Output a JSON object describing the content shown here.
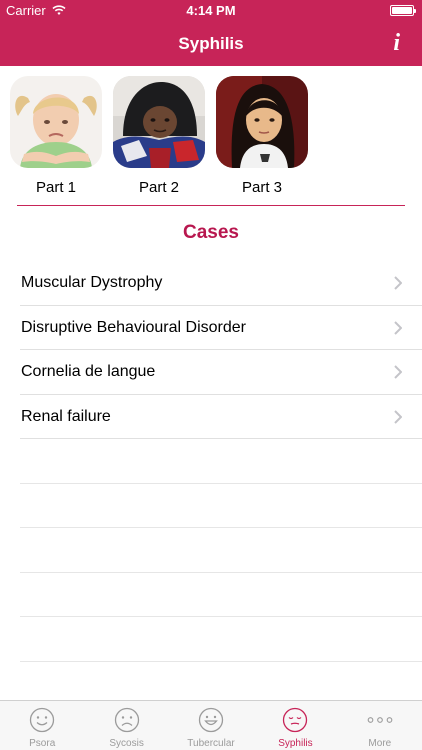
{
  "status_bar": {
    "carrier": "Carrier",
    "time": "4:14 PM"
  },
  "nav": {
    "title": "Syphilis",
    "info_label": "i"
  },
  "parts": [
    {
      "label": "Part 1"
    },
    {
      "label": "Part 2"
    },
    {
      "label": "Part 3"
    }
  ],
  "section_title": "Cases",
  "cases": [
    {
      "label": "Muscular Dystrophy"
    },
    {
      "label": "Disruptive Behavioural Disorder"
    },
    {
      "label": "Cornelia de langue"
    },
    {
      "label": "Renal failure"
    }
  ],
  "tabs": [
    {
      "label": "Psora",
      "icon": "smile-face-icon",
      "active": false
    },
    {
      "label": "Sycosis",
      "icon": "frown-face-icon",
      "active": false
    },
    {
      "label": "Tubercular",
      "icon": "grin-face-icon",
      "active": false
    },
    {
      "label": "Syphilis",
      "icon": "sleepy-face-icon",
      "active": true
    },
    {
      "label": "More",
      "icon": "more-dots-icon",
      "active": false
    }
  ],
  "colors": {
    "accent": "#c72458",
    "section_title": "#b8174f",
    "inactive_tab": "#9b9b9b"
  }
}
